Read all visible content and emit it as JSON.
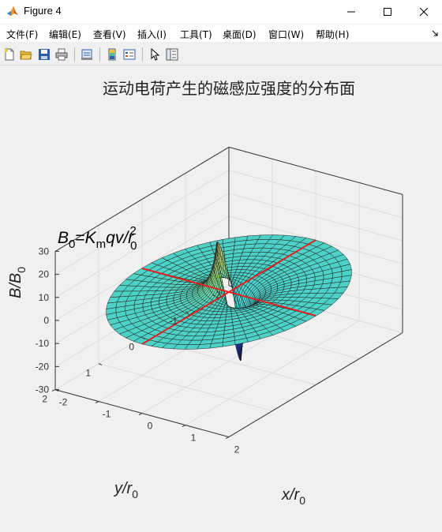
{
  "window": {
    "title": "Figure 4"
  },
  "menu": [
    "文件(F)",
    "编辑(E)",
    "查看(V)",
    "插入(I)",
    "工具(T)",
    "桌面(D)",
    "窗口(W)",
    "帮助(H)"
  ],
  "toolbar": {
    "icons": [
      "new-figure-icon",
      "open-file-icon",
      "save-icon",
      "print-icon",
      "print-preview-icon",
      "colorbar-icon",
      "legend-icon",
      "pointer-icon",
      "property-inspector-icon"
    ]
  },
  "chart_data": {
    "type": "surface",
    "title": "运动电荷产生的磁感应强度的分布面",
    "xlabel": "x/r",
    "xlabel_sub": "0",
    "ylabel": "y/r",
    "ylabel_sub": "0",
    "zlabel": "B/B",
    "zlabel_sub": "0",
    "xticks": [
      "-2",
      "-1",
      "0",
      "1",
      "2"
    ],
    "yticks": [
      "-2",
      "-1",
      "0",
      "1",
      "2"
    ],
    "zticks": [
      "-30",
      "-20",
      "-10",
      "0",
      "10",
      "20",
      "30"
    ],
    "xlim": [
      -2,
      2
    ],
    "ylim": [
      -2,
      2
    ],
    "zlim": [
      -30,
      30
    ],
    "surface": {
      "r_inner": 0.2,
      "r_outer": 2,
      "peak_max": 22,
      "peak_min": -30,
      "colormap": "jet (cyan dominant)"
    },
    "annotation": {
      "B": "B",
      "B_sub": "0",
      "eq": "=",
      "K": "K",
      "K_sub": "m",
      "qv": "qv/r",
      "r_sub": "0",
      "r_sup": "2"
    },
    "lines": [
      {
        "name": "x-axis line",
        "color": "#e02020",
        "from": [
          -2,
          0,
          0
        ],
        "to": [
          2,
          0,
          0
        ]
      },
      {
        "name": "y-axis line",
        "color": "#e02020",
        "from": [
          0,
          -2,
          0
        ],
        "to": [
          0,
          2,
          0
        ]
      }
    ],
    "grid": true
  }
}
